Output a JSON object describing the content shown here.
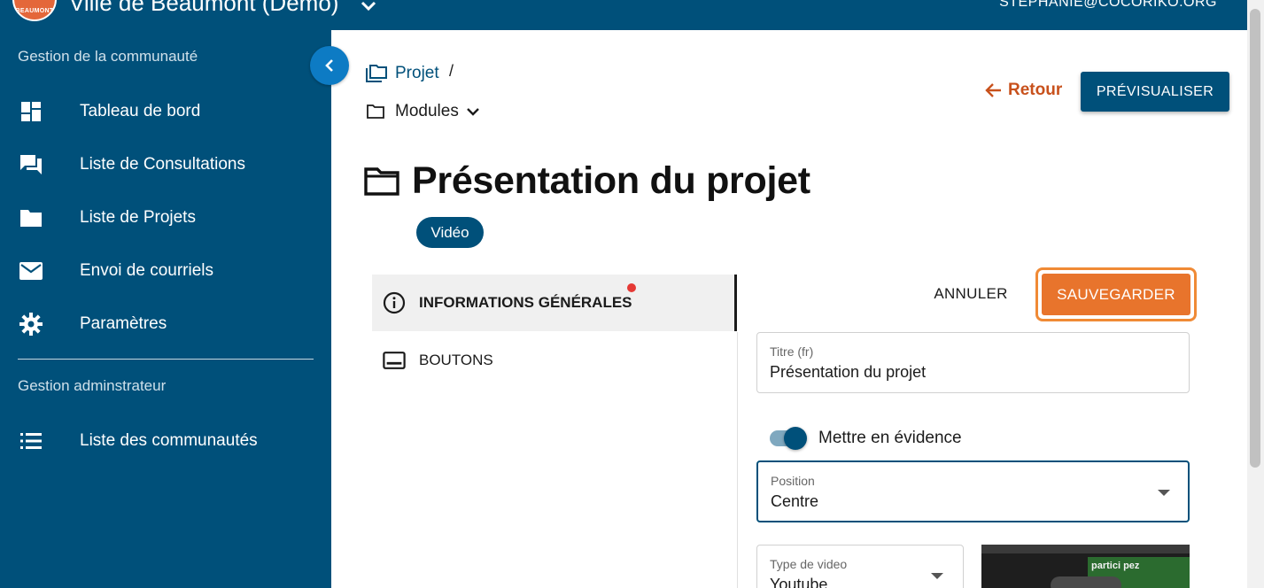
{
  "header": {
    "logo_text": "BEAUMONT",
    "app_title": "Ville de Beaumont (Demo)",
    "user_email": "STEPHANIE@COCORIKO.ORG"
  },
  "sidebar": {
    "section1_title": "Gestion de la communauté",
    "items": [
      {
        "label": "Tableau de bord",
        "icon": "dashboard-icon"
      },
      {
        "label": "Liste de Consultations",
        "icon": "forum-icon"
      },
      {
        "label": "Liste de Projets",
        "icon": "folder-icon"
      },
      {
        "label": "Envoi de courriels",
        "icon": "mail-icon"
      },
      {
        "label": "Paramètres",
        "icon": "gear-icon"
      }
    ],
    "section2_title": "Gestion adminstrateur",
    "admin_items": [
      {
        "label": "Liste des communautés",
        "icon": "list-icon"
      }
    ]
  },
  "breadcrumb": {
    "root": "Projet",
    "separator": "/",
    "current": "Modules"
  },
  "actions": {
    "back": "Retour",
    "preview": "PRÉVISUALISER"
  },
  "page": {
    "title": "Présentation du projet",
    "chip": "Vidéo"
  },
  "tabs": [
    {
      "label": "INFORMATIONS GÉNÉRALES",
      "icon": "info-icon",
      "active": true,
      "has_alert": true
    },
    {
      "label": "BOUTONS",
      "icon": "button-icon",
      "active": false
    }
  ],
  "form": {
    "cancel": "ANNULER",
    "save": "SAUVEGARDER",
    "title_field": {
      "label": "Titre (fr)",
      "value": "Présentation du projet"
    },
    "highlight_toggle": {
      "label": "Mettre en évidence",
      "on": true
    },
    "position_field": {
      "label": "Position",
      "value": "Centre"
    },
    "video_type_field": {
      "label": "Type de video",
      "value": "Youtube"
    },
    "video_thumb_text": "partici pez"
  },
  "colors": {
    "primary": "#00507a",
    "accent": "#e8742c",
    "back_link": "#c8511c",
    "chip_alert": "#e53935"
  }
}
